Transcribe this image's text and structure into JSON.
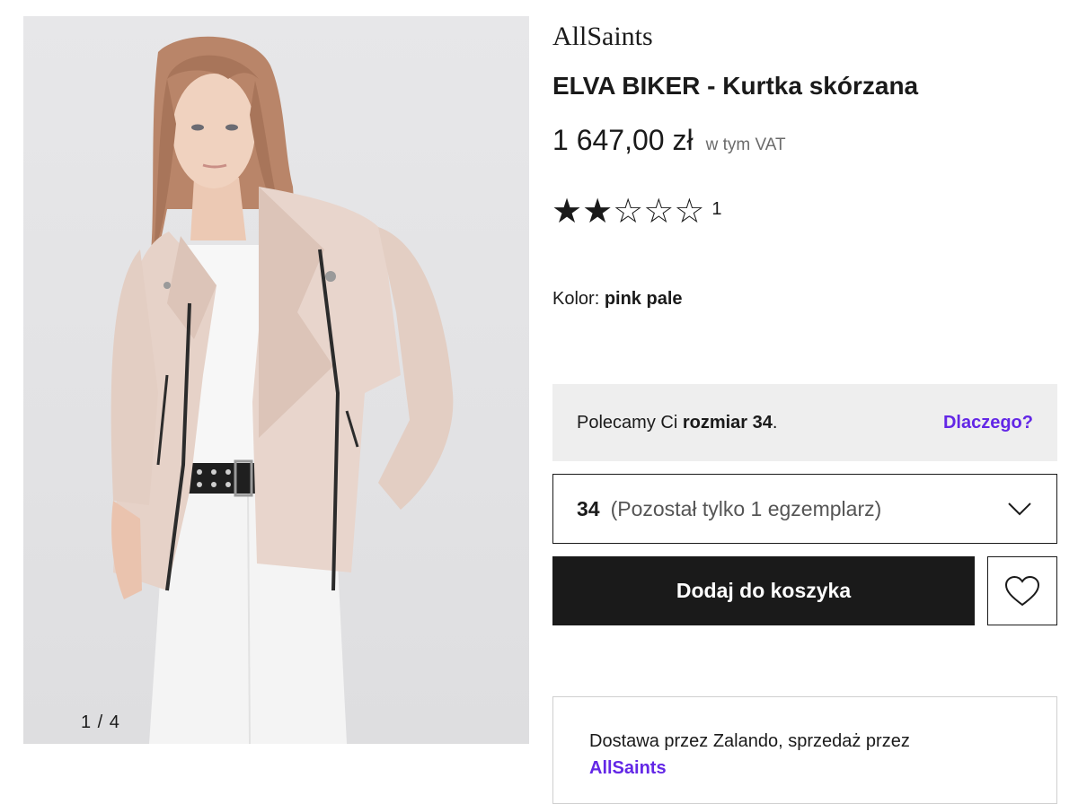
{
  "gallery": {
    "counter": "1 / 4",
    "image_alt": "Model wearing pale pink leather biker jacket with white top, studded black belt and white jeans"
  },
  "product": {
    "brand": "AllSaints",
    "name": "ELVA BIKER - Kurtka skórzana",
    "price": "1 647,00 zł",
    "vat_note": "w tym VAT",
    "rating": {
      "value": 2,
      "max": 5,
      "count": "1",
      "filled_star": "★",
      "empty_star": "☆"
    },
    "color_label": "Kolor:",
    "color_value": "pink pale"
  },
  "size_recommendation": {
    "prefix": "Polecamy Ci ",
    "size_text": "rozmiar 34",
    "suffix": ".",
    "link": "Dlaczego?"
  },
  "size_selector": {
    "selected": "34",
    "note": "(Pozostał tylko 1 egzemplarz)",
    "icon": "chevron-down-icon"
  },
  "actions": {
    "add_to_cart": "Dodaj do koszyka",
    "wishlist_icon": "heart-icon"
  },
  "delivery": {
    "text": "Dostawa przez Zalando, sprzedaż przez",
    "seller": "AllSaints"
  },
  "colors": {
    "accent": "#6327e6",
    "button_bg": "#1a1a1a",
    "recommend_bg": "#eeeeee",
    "jacket": "#e8d5cc"
  }
}
